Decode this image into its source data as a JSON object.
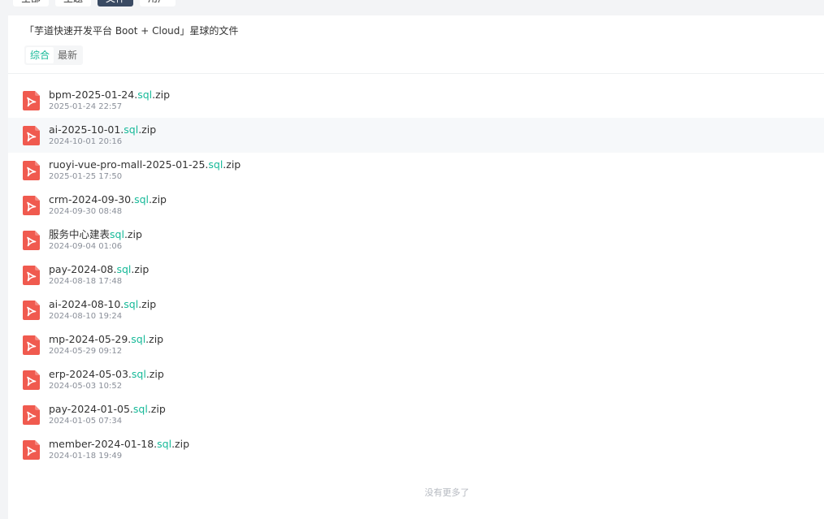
{
  "top_tabs": [
    {
      "label": "全部",
      "active": false
    },
    {
      "label": "主题",
      "active": false
    },
    {
      "label": "文件",
      "active": true
    },
    {
      "label": "用户",
      "active": false
    }
  ],
  "panel": {
    "title": "「芋道快速开发平台 Boot + Cloud」星球的文件",
    "sort_tabs": [
      {
        "label": "综合",
        "active": true
      },
      {
        "label": "最新",
        "active": false
      }
    ]
  },
  "files": [
    {
      "prefix": "bpm-2025-01-24.",
      "hl": "sql",
      "suffix": ".zip",
      "time": "2025-01-24 22:57"
    },
    {
      "prefix": "ai-2025-10-01.",
      "hl": "sql",
      "suffix": ".zip",
      "time": "2024-10-01 20:16"
    },
    {
      "prefix": "ruoyi-vue-pro-mall-2025-01-25.",
      "hl": "sql",
      "suffix": ".zip",
      "time": "2025-01-25 17:50"
    },
    {
      "prefix": "crm-2024-09-30.",
      "hl": "sql",
      "suffix": ".zip",
      "time": "2024-09-30 08:48"
    },
    {
      "prefix": "服务中心建表",
      "hl": "sql",
      "suffix": ".zip",
      "time": "2024-09-04 01:06"
    },
    {
      "prefix": "pay-2024-08.",
      "hl": "sql",
      "suffix": ".zip",
      "time": "2024-08-18 17:48"
    },
    {
      "prefix": "ai-2024-08-10.",
      "hl": "sql",
      "suffix": ".zip",
      "time": "2024-08-10 19:24"
    },
    {
      "prefix": "mp-2024-05-29.",
      "hl": "sql",
      "suffix": ".zip",
      "time": "2024-05-29 09:12"
    },
    {
      "prefix": "erp-2024-05-03.",
      "hl": "sql",
      "suffix": ".zip",
      "time": "2024-05-03 10:52"
    },
    {
      "prefix": "pay-2024-01-05.",
      "hl": "sql",
      "suffix": ".zip",
      "time": "2024-01-05 07:34"
    },
    {
      "prefix": "member-2024-01-18.",
      "hl": "sql",
      "suffix": ".zip",
      "time": "2024-01-18 19:49"
    }
  ],
  "hovered_index": 1,
  "file_icon": "pdf-icon",
  "no_more_text": "没有更多了",
  "colors": {
    "accent": "#16b998",
    "pdf_icon": "#f05a4f",
    "active_tab": "#3a4a63"
  }
}
